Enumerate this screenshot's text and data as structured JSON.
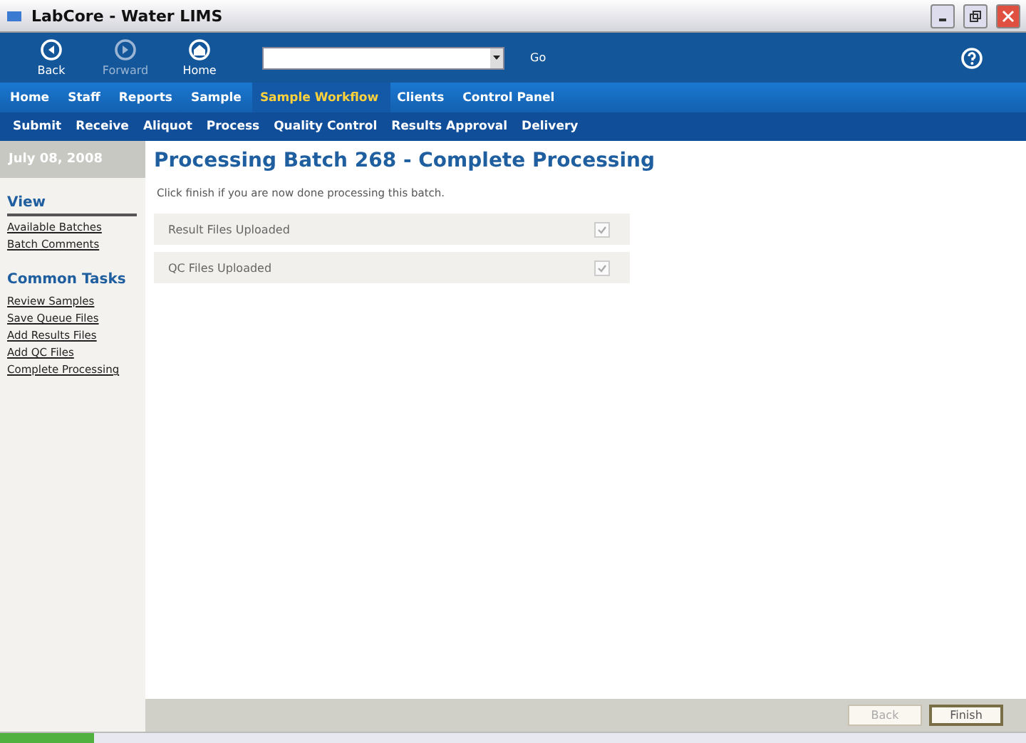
{
  "window": {
    "title": "LabCore - Water LIMS"
  },
  "toolbar": {
    "buttons": [
      {
        "label": "Back",
        "kind": "back",
        "disabled": false
      },
      {
        "label": "Forward",
        "kind": "forward",
        "disabled": true
      },
      {
        "label": "Home",
        "kind": "home",
        "disabled": false
      }
    ],
    "go": "Go"
  },
  "main_nav": [
    {
      "label": "Home",
      "selected": false
    },
    {
      "label": "Staff",
      "selected": false
    },
    {
      "label": "Reports",
      "selected": false
    },
    {
      "label": "Sample",
      "selected": false
    },
    {
      "label": "Sample Workflow",
      "selected": true
    },
    {
      "label": "Clients",
      "selected": false
    },
    {
      "label": "Control Panel",
      "selected": false
    }
  ],
  "sub_nav": [
    "Submit",
    "Receive",
    "Aliquot",
    "Process",
    "Quality Control",
    "Results Approval",
    "Delivery"
  ],
  "sidebar": {
    "date": "July 08, 2008",
    "sections": [
      {
        "title": "View",
        "links": [
          "Available Batches",
          "Batch Comments"
        ]
      },
      {
        "title": "Common Tasks",
        "links": [
          "Review Samples",
          "Save Queue Files",
          "Add Results Files",
          "Add QC Files",
          "Complete Processing"
        ]
      }
    ]
  },
  "content": {
    "heading": "Processing Batch 268 - Complete Processing",
    "instruction": "Click finish if you are now done processing this batch.",
    "items": [
      {
        "label": "Result Files Uploaded",
        "checked": true
      },
      {
        "label": "QC Files Uploaded",
        "checked": true
      }
    ]
  },
  "footer": {
    "buttons": [
      {
        "label": "Back",
        "disabled": true
      },
      {
        "label": "Finish",
        "disabled": false
      }
    ]
  }
}
